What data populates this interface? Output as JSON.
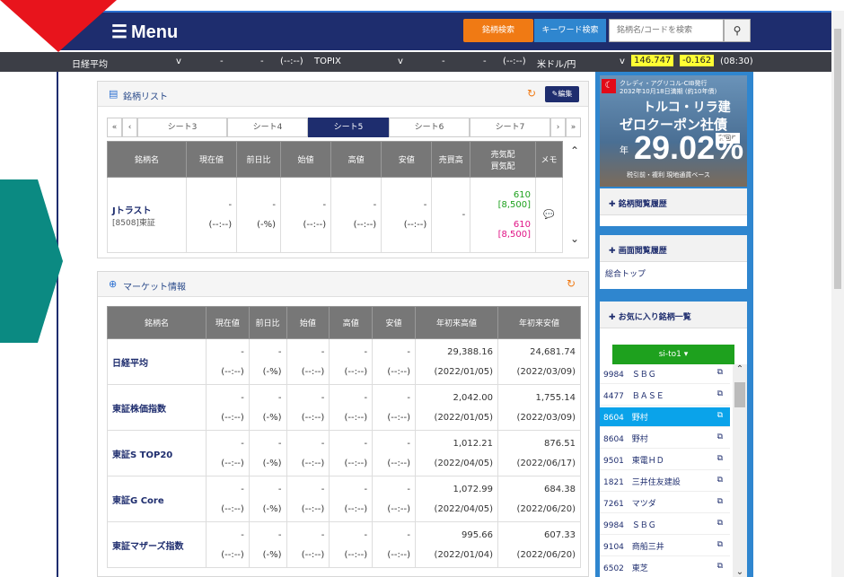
{
  "header": {
    "menu_label": "Menu",
    "stock_search_label": "銘柄検索",
    "keyword_search_label": "キーワード検索",
    "search_placeholder": "銘柄名/コードを検索",
    "search_icon": "magnifier-icon"
  },
  "ticker": {
    "n225_label": "日経平均",
    "n225_arrow": "v",
    "n225_val": "-",
    "n225_chg": "-",
    "n225_time": "(--:--)",
    "topix_label": "TOPIX",
    "topix_arrow": "v",
    "topix_val": "-",
    "topix_chg": "-",
    "topix_time": "(--:--)",
    "usdjpy_label": "米ドル/円",
    "usdjpy_arrow": "v",
    "usdjpy_val": "146.747",
    "usdjpy_chg": "-0.162",
    "usdjpy_time": "(08:30)"
  },
  "watchlist": {
    "title": "銘柄リスト",
    "edit_label": "編集",
    "tabs": [
      "«",
      "‹",
      "シート3",
      "シート4",
      "シート5",
      "シート6",
      "シート7",
      "›",
      "»"
    ],
    "active_tab": "シート5",
    "columns": [
      "銘柄名",
      "現在値",
      "前日比",
      "始値",
      "高値",
      "安値",
      "売買高",
      "売気配 買気配",
      "メモ"
    ],
    "col_ask": "売気配",
    "col_bid": "買気配",
    "row": {
      "name": "Jトラスト",
      "code": "[8508]東証",
      "price": "-",
      "price_time": "(--:--)",
      "change": "-",
      "change_pct": "(-%)",
      "open": "-",
      "open_time": "(--:--)",
      "high": "-",
      "high_time": "(--:--)",
      "low": "-",
      "low_time": "(--:--)",
      "volume": "-",
      "ask": "610",
      "ask_qty": "[8,500]",
      "bid": "610",
      "bid_qty": "[8,500]"
    }
  },
  "market": {
    "title": "マーケット情報",
    "columns": [
      "銘柄名",
      "現在値",
      "前日比",
      "始値",
      "高値",
      "安値",
      "年初来高値",
      "年初来安値"
    ],
    "rows": [
      {
        "name": "日経平均",
        "p": "-",
        "pt": "(--:--)",
        "c": "-",
        "cp": "(-%)",
        "o": "-",
        "ot": "(--:--)",
        "h": "-",
        "ht": "(--:--)",
        "l": "-",
        "lt": "(--:--)",
        "yh": "29,388.16",
        "yhd": "(2022/01/05)",
        "yl": "24,681.74",
        "yld": "(2022/03/09)"
      },
      {
        "name": "東証株価指数",
        "p": "-",
        "pt": "(--:--)",
        "c": "-",
        "cp": "(-%)",
        "o": "-",
        "ot": "(--:--)",
        "h": "-",
        "ht": "(--:--)",
        "l": "-",
        "lt": "(--:--)",
        "yh": "2,042.00",
        "yhd": "(2022/01/05)",
        "yl": "1,755.14",
        "yld": "(2022/03/09)"
      },
      {
        "name": "東証S TOP20",
        "p": "-",
        "pt": "(--:--)",
        "c": "-",
        "cp": "(-%)",
        "o": "-",
        "ot": "(--:--)",
        "h": "-",
        "ht": "(--:--)",
        "l": "-",
        "lt": "(--:--)",
        "yh": "1,012.21",
        "yhd": "(2022/04/05)",
        "yl": "876.51",
        "yld": "(2022/06/17)"
      },
      {
        "name": "東証G Core",
        "p": "-",
        "pt": "(--:--)",
        "c": "-",
        "cp": "(-%)",
        "o": "-",
        "ot": "(--:--)",
        "h": "-",
        "ht": "(--:--)",
        "l": "-",
        "lt": "(--:--)",
        "yh": "1,072.99",
        "yhd": "(2022/04/05)",
        "yl": "684.38",
        "yld": "(2022/06/20)"
      },
      {
        "name": "東証マザーズ指数",
        "p": "-",
        "pt": "(--:--)",
        "c": "-",
        "cp": "(-%)",
        "o": "-",
        "ot": "(--:--)",
        "h": "-",
        "ht": "(--:--)",
        "l": "-",
        "lt": "(--:--)",
        "yh": "995.66",
        "yhd": "(2022/01/04)",
        "yl": "607.33",
        "yld": "(2022/06/20)"
      }
    ]
  },
  "sidebar": {
    "ad": {
      "line1": "クレディ・アグリコル-CIB発行",
      "line2": "2032年10月18日満期 (約10年債)",
      "line3": "トルコ・リラ建",
      "line4": "ゼロクーポン社債",
      "yield_label": "利回り",
      "year_label": "年",
      "rate": "29.02%",
      "footer": "税引前・複利 現地通貨ベース"
    },
    "history_title": "銘柄閲覧履歴",
    "screen_history_title": "画面閲覧履歴",
    "screen_history_item": "総合トップ",
    "favorites_title": "お気に入り銘柄一覧",
    "favorites_select": "si-to1 ▾",
    "favorites": [
      {
        "code": "9984",
        "name": "ＳＢＧ"
      },
      {
        "code": "4477",
        "name": "ＢＡＳＥ"
      },
      {
        "code": "8604",
        "name": "野村"
      },
      {
        "code": "8604",
        "name": "野村"
      },
      {
        "code": "9501",
        "name": "東電ＨＤ"
      },
      {
        "code": "1821",
        "name": "三井住友建設"
      },
      {
        "code": "7261",
        "name": "マツダ"
      },
      {
        "code": "9984",
        "name": "ＳＢＧ"
      },
      {
        "code": "9104",
        "name": "商船三井"
      },
      {
        "code": "6502",
        "name": "東芝"
      }
    ],
    "selected_index": 2
  },
  "colors": {
    "navy": "#1e2d6e",
    "orange": "#f07a14",
    "blue": "#2f86cf",
    "red_arrow": "#e8141c",
    "teal_arrow": "#0b8a82",
    "positive": "#1ea11e",
    "negative": "#e01486"
  }
}
